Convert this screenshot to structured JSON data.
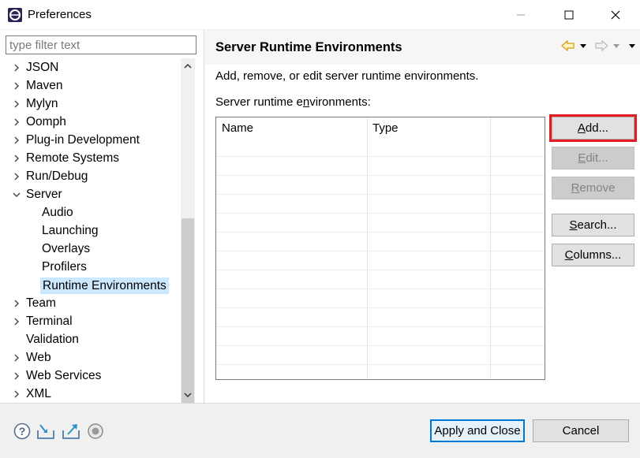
{
  "window": {
    "title": "Preferences",
    "minimize_icon": "minimize-icon",
    "maximize_icon": "maximize-icon",
    "close_icon": "close-icon"
  },
  "filter": {
    "placeholder": "type filter text",
    "value": ""
  },
  "tree": {
    "items": [
      {
        "label": "JSON",
        "level": 0,
        "expander": "collapsed"
      },
      {
        "label": "Maven",
        "level": 0,
        "expander": "collapsed"
      },
      {
        "label": "Mylyn",
        "level": 0,
        "expander": "collapsed"
      },
      {
        "label": "Oomph",
        "level": 0,
        "expander": "collapsed"
      },
      {
        "label": "Plug-in Development",
        "level": 0,
        "expander": "collapsed"
      },
      {
        "label": "Remote Systems",
        "level": 0,
        "expander": "collapsed"
      },
      {
        "label": "Run/Debug",
        "level": 0,
        "expander": "collapsed"
      },
      {
        "label": "Server",
        "level": 0,
        "expander": "expanded"
      },
      {
        "label": "Audio",
        "level": 1,
        "expander": "none"
      },
      {
        "label": "Launching",
        "level": 1,
        "expander": "none"
      },
      {
        "label": "Overlays",
        "level": 1,
        "expander": "none"
      },
      {
        "label": "Profilers",
        "level": 1,
        "expander": "none"
      },
      {
        "label": "Runtime Environments",
        "level": 1,
        "expander": "none",
        "selected": true
      },
      {
        "label": "Team",
        "level": 0,
        "expander": "collapsed"
      },
      {
        "label": "Terminal",
        "level": 0,
        "expander": "collapsed"
      },
      {
        "label": "Validation",
        "level": 0,
        "expander": "none"
      },
      {
        "label": "Web",
        "level": 0,
        "expander": "collapsed"
      },
      {
        "label": "Web Services",
        "level": 0,
        "expander": "collapsed"
      },
      {
        "label": "XML",
        "level": 0,
        "expander": "collapsed"
      }
    ]
  },
  "page": {
    "title": "Server Runtime Environments",
    "description": "Add, remove, or edit server runtime environments.",
    "list_label_before": "Server runtime e",
    "list_label_mnemonic": "n",
    "list_label_after": "vironments:",
    "nav_icons": [
      "back-arrow-icon",
      "back-dropdown-icon",
      "forward-arrow-icon",
      "forward-dropdown-icon",
      "view-menu-icon"
    ]
  },
  "table": {
    "columns": [
      "Name",
      "Type",
      ""
    ],
    "rows": []
  },
  "buttons": {
    "add": {
      "mnemonic": "A",
      "rest": "dd...",
      "enabled": true
    },
    "edit": {
      "mnemonic": "E",
      "rest": "dit...",
      "enabled": false
    },
    "remove": {
      "mnemonic": "R",
      "rest": "emove",
      "enabled": false
    },
    "search": {
      "mnemonic": "S",
      "rest": "earch...",
      "enabled": true
    },
    "columns": {
      "mnemonic": "C",
      "rest": "olumns...",
      "enabled": true
    }
  },
  "footer": {
    "icons": [
      "help-icon",
      "import-icon",
      "export-icon",
      "record-icon"
    ],
    "apply_close_label": "Apply and Close",
    "cancel_label": "Cancel"
  },
  "colors": {
    "highlight_outline": "#e51b24",
    "selection": "#cce8ff",
    "primary_border": "#0078d7",
    "nav_arrow": "#e0a11b"
  }
}
